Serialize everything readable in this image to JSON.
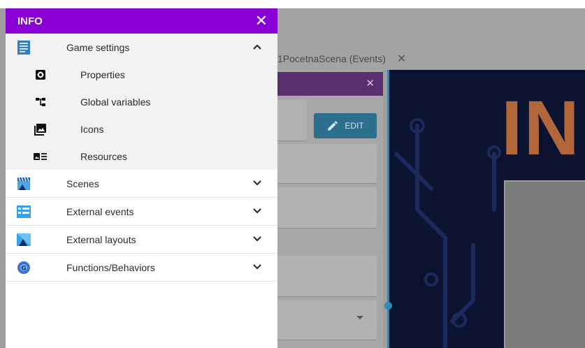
{
  "drawer": {
    "title": "INFO",
    "header_color": "#8a00d4",
    "game_settings": {
      "label": "Game settings",
      "expanded": true,
      "items": [
        {
          "label": "Properties",
          "icon": "gear-icon"
        },
        {
          "label": "Global variables",
          "icon": "variables-tree-icon"
        },
        {
          "label": "Icons",
          "icon": "image-icon"
        },
        {
          "label": "Resources",
          "icon": "resources-icon"
        }
      ]
    },
    "sections": [
      {
        "label": "Scenes",
        "icon": "scenes-clapper-icon"
      },
      {
        "label": "External events",
        "icon": "external-events-icon"
      },
      {
        "label": "External layouts",
        "icon": "external-layouts-icon"
      },
      {
        "label": "Functions/Behaviors",
        "icon": "functions-behaviors-icon"
      }
    ]
  },
  "background": {
    "tab_label": "1PocetnaScena (Events)",
    "edit_button_label": "EDIT",
    "preview_text": "IN"
  }
}
